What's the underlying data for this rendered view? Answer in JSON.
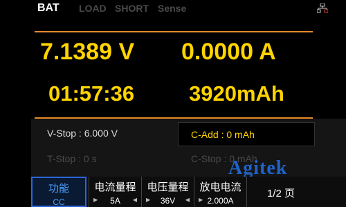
{
  "tabs": [
    "BAT",
    "LOAD",
    "SHORT",
    "Sense"
  ],
  "icons": {
    "network": "network-icon"
  },
  "readout": {
    "voltage": "7.1389 V",
    "current": "0.0000 A",
    "time": "01:57:36",
    "capacity": "3920mAh"
  },
  "params": {
    "v_stop": "V-Stop :   6.000 V",
    "c_add": "C-Add : 0 mAh",
    "t_stop": "T-Stop :          0 s",
    "c_stop": "C-Stop :     0 mAh"
  },
  "watermark": "Agitek",
  "softkeys": [
    {
      "label": "功能",
      "value": "CC"
    },
    {
      "label": "电流量程",
      "value": "5A"
    },
    {
      "label": "电压量程",
      "value": "36V"
    },
    {
      "label": "放电电流",
      "value": "2.000A"
    },
    {
      "label": "1/2 页",
      "value": ""
    }
  ],
  "colors": {
    "readout": "#ffd400",
    "accent": "#e88a2a",
    "selected": "#2b67d9"
  }
}
